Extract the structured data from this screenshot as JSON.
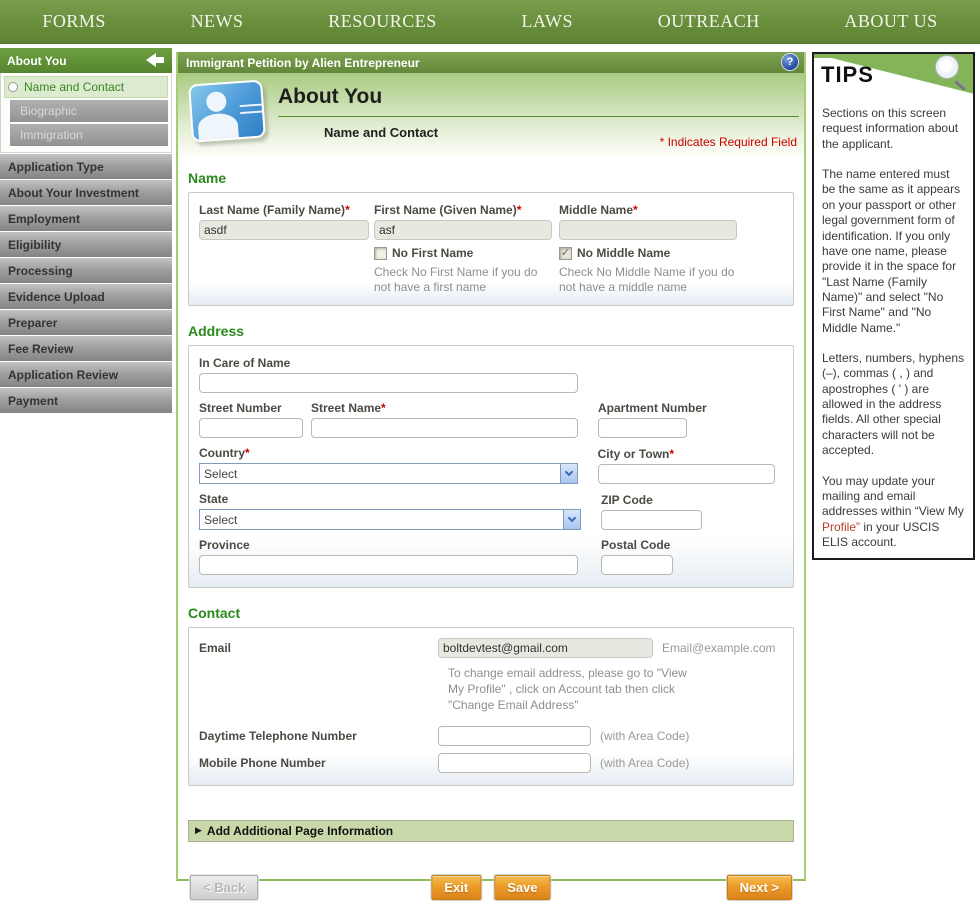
{
  "colors": {
    "nav_green": "#688e3c",
    "accent_green": "#2a8a1c",
    "required_red": "#cc0000",
    "button_orange": "#ec9c28",
    "select_border_blue": "#7f9db9",
    "tips_border": "#1c1c1c"
  },
  "nav": {
    "items": [
      "FORMS",
      "NEWS",
      "RESOURCES",
      "LAWS",
      "OUTREACH",
      "ABOUT US"
    ]
  },
  "sidebar": {
    "group_header": "About You",
    "sub_items": [
      {
        "label": "Name and Contact",
        "state": "active"
      },
      {
        "label": "Biographic",
        "state": "disabled"
      },
      {
        "label": "Immigration",
        "state": "disabled"
      }
    ],
    "sections": [
      "Application Type",
      "About Your Investment",
      "Employment",
      "Eligibility",
      "Processing",
      "Evidence Upload",
      "Preparer",
      "Fee Review",
      "Application Review",
      "Payment"
    ]
  },
  "header": {
    "form_title": "Immigrant Petition by Alien Entrepreneur",
    "help_icon": "?",
    "page_title": "About You",
    "page_subtitle": "Name and Contact",
    "required_note": "* Indicates Required Field"
  },
  "ui": {
    "required_marker": "*",
    "expander_icon": "▶",
    "check_icon": "✓"
  },
  "name_section": {
    "heading": "Name",
    "last_name": {
      "label": "Last Name (Family Name)",
      "value": "asdf"
    },
    "first_name": {
      "label": "First Name (Given Name)",
      "value": "asf",
      "checkbox_label": "No First Name",
      "checkbox_hint": "Check No First Name if you do not have a first name"
    },
    "middle_name": {
      "label": "Middle Name",
      "value": "",
      "checkbox_label": "No Middle Name",
      "checkbox_hint": "Check No Middle Name if you do not have a middle name"
    }
  },
  "address_section": {
    "heading": "Address",
    "in_care_of_label": "In Care of Name",
    "street_number_label": "Street Number",
    "street_name_label": "Street Name",
    "apartment_label": "Apartment Number",
    "country_label": "Country",
    "country_value": "Select",
    "city_label": "City or Town",
    "state_label": "State",
    "state_value": "Select",
    "zip_label": "ZIP Code",
    "province_label": "Province",
    "postal_label": "Postal Code"
  },
  "contact_section": {
    "heading": "Contact",
    "email_label": "Email",
    "email_value": "boltdevtest@gmail.com",
    "email_hint": "Email@example.com",
    "email_note": "To change email address, please go to \"View My Profile\" , click on Account tab then click \"Change Email Address\"",
    "daytime_label": "Daytime Telephone Number",
    "mobile_label": "Mobile Phone Number",
    "phone_hint": "(with Area Code)"
  },
  "footer": {
    "additional_label": "Add Additional Page Information",
    "back": "< Back",
    "exit": "Exit",
    "save": "Save",
    "next": "Next >"
  },
  "tips": {
    "title": "TIPS",
    "p1": "Sections on this screen request information about the applicant.",
    "p2": "The name entered must be the same as it appears on your passport or other legal government form of identification. If you only have one name, please provide it in the space for \"Last Name (Family Name)\" and select \"No First Name\" and \"No Middle Name.\"",
    "p3": "Letters, numbers, hyphens (–), commas ( , ) and apostrophes ( ' ) are allowed in the address fields. All other special characters will not be accepted.",
    "p4_before": "You may update your mailing and email addresses within “View My ",
    "p4_highlight": "Profile”",
    "p4_after": " in your USCIS ELIS account."
  }
}
